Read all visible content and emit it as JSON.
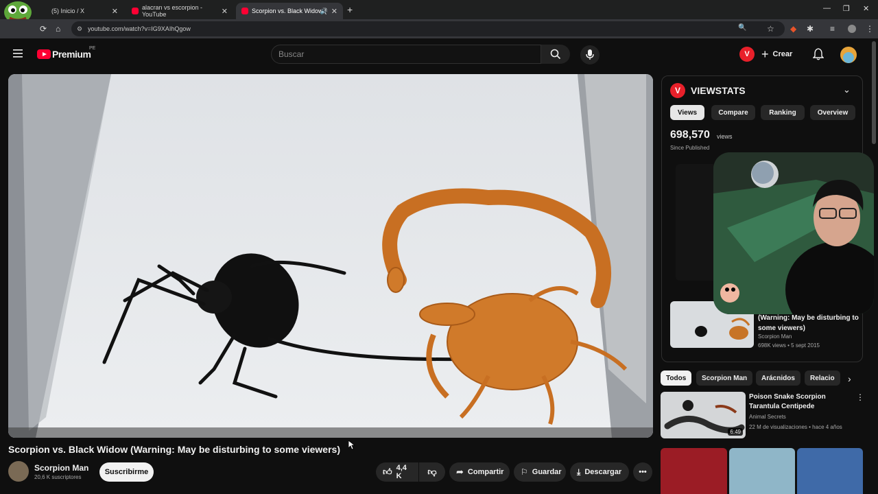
{
  "browser": {
    "tabs": [
      {
        "label": "(5) Inicio / X"
      },
      {
        "label": "alacran vs escorpion - YouTube"
      },
      {
        "label": "Scorpion vs. Black Widow ("
      }
    ],
    "url": "youtube.com/watch?v=IG9XAIhQgow",
    "overlay_logo": "x21"
  },
  "header": {
    "logo_text": "Premium",
    "region": "PE",
    "search_placeholder": "Buscar",
    "create_label": "Crear",
    "ext_badge": "V"
  },
  "video": {
    "title": "Scorpion vs. Black Widow (Warning: May be disturbing to some viewers)",
    "channel": "Scorpion Man",
    "subscribers": "20,6 K suscriptores",
    "subscribe_label": "Suscribirme",
    "likes": "4,4 K",
    "share_label": "Compartir",
    "save_label": "Guardar",
    "download_label": "Descargar"
  },
  "viewstats": {
    "title": "VIEWSTATS",
    "tabs": [
      "Views",
      "Compare",
      "Ranking",
      "Overview"
    ],
    "active_tab": "Views",
    "views_count": "698,570",
    "views_unit": "views",
    "since": "Since Published",
    "card": {
      "title": "(Warning: May be disturbing to some viewers)",
      "channel": "Scorpion Man",
      "meta": "698K views • 5 sept 2015"
    }
  },
  "chips": [
    "Todos",
    "Scorpion Man",
    "Arácnidos",
    "Relacio"
  ],
  "recommendations": [
    {
      "title": "Poison Snake Scorpion Tarantula Centipede",
      "channel": "Animal Secrets",
      "meta": "22 M de visualizaciones • hace 4 años",
      "duration": "6:49"
    }
  ],
  "colors": {
    "brand_red": "#ff0033",
    "viewstats_red": "#e8202a",
    "bg": "#0f0f0f"
  }
}
